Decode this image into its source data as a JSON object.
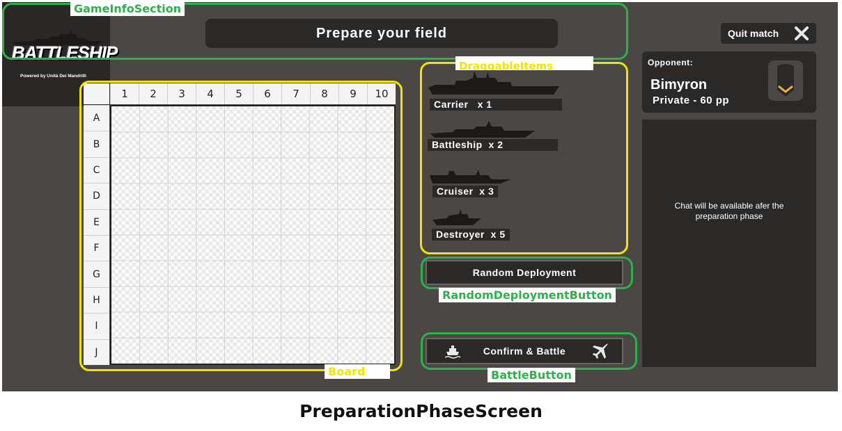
{
  "app": {
    "logo_text": "BATTLESHIP",
    "powered_by": "Powered by Unità Dei Mandrilli"
  },
  "header": {
    "title": "Prepare your field",
    "quit_label": "Quit match"
  },
  "opponent": {
    "label": "Opponent:",
    "name": "Bimyron",
    "rank": "Private  -  60 pp"
  },
  "chat": {
    "message": "Chat will be available afer the preparation phase"
  },
  "board": {
    "columns": [
      "1",
      "2",
      "3",
      "4",
      "5",
      "6",
      "7",
      "8",
      "9",
      "10"
    ],
    "rows": [
      "A",
      "B",
      "C",
      "D",
      "E",
      "F",
      "G",
      "H",
      "I",
      "J"
    ]
  },
  "ships": [
    {
      "name": "Carrier",
      "label": "Carrier   x 1",
      "count": 1
    },
    {
      "name": "Battleship",
      "label": "Battleship  x 2",
      "count": 2
    },
    {
      "name": "Cruiser",
      "label": "Cruiser  x 3",
      "count": 3
    },
    {
      "name": "Destroyer",
      "label": "Destroyer  x 5",
      "count": 5
    }
  ],
  "buttons": {
    "random_deployment": "Random Deployment",
    "confirm_battle": "Confirm & Battle"
  },
  "annotations": {
    "game_info_section": "GameInfoSection",
    "draggable_items": "DraggableItems",
    "board": "Board",
    "random_deployment_button": "RandomDeploymentButton",
    "battle_button": "BattleButton"
  },
  "caption": "PreparationPhaseScreen",
  "colors": {
    "background": "#4a4744",
    "panel": "#2b2927",
    "annotation_green": "#2db24a",
    "annotation_yellow": "#f3e500"
  }
}
